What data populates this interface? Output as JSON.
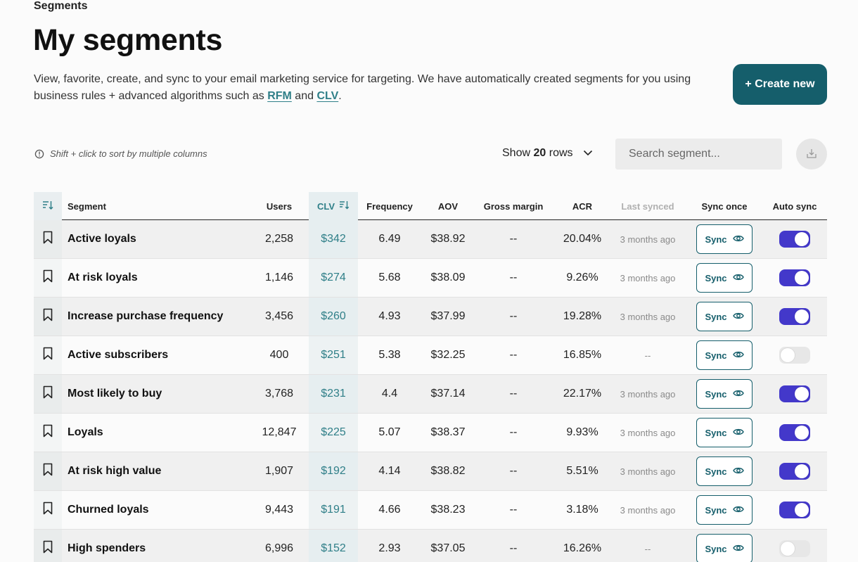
{
  "breadcrumb": "Segments",
  "title": "My segments",
  "description": {
    "text_before": "View, favorite, create, and sync to your email marketing service for targeting. We have automatically created segments for you using business rules + advanced algorithms such as ",
    "link_rfm": "RFM",
    "text_and": " and ",
    "link_clv": "CLV",
    "text_end": "."
  },
  "create_button": "+ Create new",
  "hint": "Shift + click to sort by multiple columns",
  "rows_select": {
    "prefix": "Show",
    "count": "20",
    "suffix": "rows"
  },
  "search": {
    "placeholder": "Search segment..."
  },
  "columns": {
    "segment": "Segment",
    "users": "Users",
    "clv": "CLV",
    "frequency": "Frequency",
    "aov": "AOV",
    "gross_margin": "Gross margin",
    "acr": "ACR",
    "last_synced": "Last synced",
    "sync_once": "Sync once",
    "auto_sync": "Auto sync"
  },
  "sync_label": "Sync",
  "colors": {
    "accent": "#155e6b",
    "link": "#2f7f88",
    "toggle_on": "#4338ca"
  },
  "rows": [
    {
      "segment": "Active loyals",
      "users": "2,258",
      "clv": "$342",
      "frequency": "6.49",
      "aov": "$38.92",
      "gross_margin": "--",
      "acr": "20.04%",
      "last_synced": "3 months ago",
      "auto_sync": true
    },
    {
      "segment": "At risk loyals",
      "users": "1,146",
      "clv": "$274",
      "frequency": "5.68",
      "aov": "$38.09",
      "gross_margin": "--",
      "acr": "9.26%",
      "last_synced": "3 months ago",
      "auto_sync": true
    },
    {
      "segment": "Increase purchase frequency",
      "users": "3,456",
      "clv": "$260",
      "frequency": "4.93",
      "aov": "$37.99",
      "gross_margin": "--",
      "acr": "19.28%",
      "last_synced": "3 months ago",
      "auto_sync": true
    },
    {
      "segment": "Active subscribers",
      "users": "400",
      "clv": "$251",
      "frequency": "5.38",
      "aov": "$32.25",
      "gross_margin": "--",
      "acr": "16.85%",
      "last_synced": "--",
      "auto_sync": false
    },
    {
      "segment": "Most likely to buy",
      "users": "3,768",
      "clv": "$231",
      "frequency": "4.4",
      "aov": "$37.14",
      "gross_margin": "--",
      "acr": "22.17%",
      "last_synced": "3 months ago",
      "auto_sync": true
    },
    {
      "segment": "Loyals",
      "users": "12,847",
      "clv": "$225",
      "frequency": "5.07",
      "aov": "$38.37",
      "gross_margin": "--",
      "acr": "9.93%",
      "last_synced": "3 months ago",
      "auto_sync": true
    },
    {
      "segment": "At risk high value",
      "users": "1,907",
      "clv": "$192",
      "frequency": "4.14",
      "aov": "$38.82",
      "gross_margin": "--",
      "acr": "5.51%",
      "last_synced": "3 months ago",
      "auto_sync": true
    },
    {
      "segment": "Churned loyals",
      "users": "9,443",
      "clv": "$191",
      "frequency": "4.66",
      "aov": "$38.23",
      "gross_margin": "--",
      "acr": "3.18%",
      "last_synced": "3 months ago",
      "auto_sync": true
    },
    {
      "segment": "High spenders",
      "users": "6,996",
      "clv": "$152",
      "frequency": "2.93",
      "aov": "$37.05",
      "gross_margin": "--",
      "acr": "16.26%",
      "last_synced": "--",
      "auto_sync": false
    }
  ]
}
